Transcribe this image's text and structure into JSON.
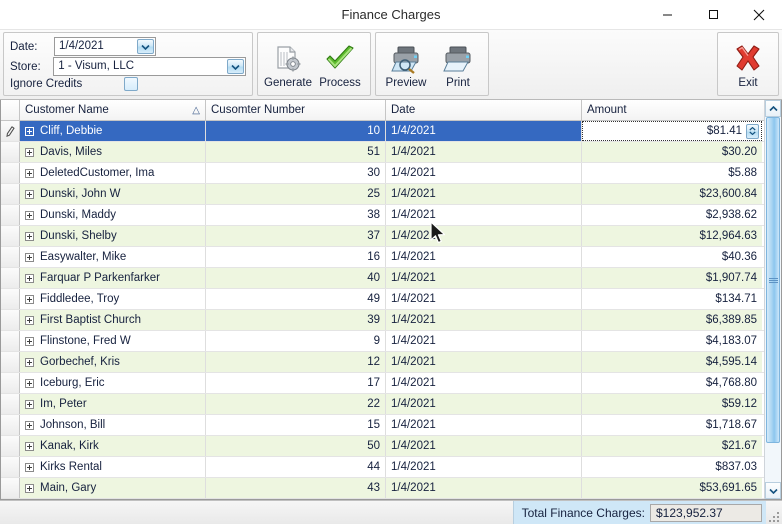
{
  "window": {
    "title": "Finance Charges",
    "minimize_label": "Minimize",
    "maximize_label": "Maximize",
    "close_label": "Close"
  },
  "toolbar": {
    "date_label": "Date:",
    "date_value": "1/4/2021",
    "store_label": "Store:",
    "store_value": "1 - Visum, LLC",
    "ignore_credits_label": "Ignore Credits",
    "ignore_credits_checked": false,
    "buttons": [
      {
        "label": "Generate",
        "icon": "document-gear-icon"
      },
      {
        "label": "Process",
        "icon": "green-check-icon"
      },
      {
        "label": "Preview",
        "icon": "printer-preview-icon"
      },
      {
        "label": "Print",
        "icon": "printer-icon"
      },
      {
        "label": "Exit",
        "icon": "red-x-icon"
      }
    ]
  },
  "grid": {
    "columns": [
      {
        "key": "name",
        "label": "Customer Name",
        "sort": "△"
      },
      {
        "key": "num",
        "label": "Cusomter Number",
        "sort": ""
      },
      {
        "key": "date",
        "label": "Date",
        "sort": ""
      },
      {
        "key": "amt",
        "label": "Amount",
        "sort": ""
      }
    ],
    "rows": [
      {
        "name": "Cliff, Debbie",
        "num": "10",
        "date": "1/4/2021",
        "amt": "$81.41",
        "selected": true,
        "editing": true
      },
      {
        "name": "Davis, Miles",
        "num": "51",
        "date": "1/4/2021",
        "amt": "$30.20",
        "selected": false,
        "editing": false
      },
      {
        "name": "DeletedCustomer, Ima",
        "num": "30",
        "date": "1/4/2021",
        "amt": "$5.88",
        "selected": false,
        "editing": false
      },
      {
        "name": "Dunski, John W",
        "num": "25",
        "date": "1/4/2021",
        "amt": "$23,600.84",
        "selected": false,
        "editing": false
      },
      {
        "name": "Dunski, Maddy",
        "num": "38",
        "date": "1/4/2021",
        "amt": "$2,938.62",
        "selected": false,
        "editing": false
      },
      {
        "name": "Dunski, Shelby",
        "num": "37",
        "date": "1/4/2021",
        "amt": "$12,964.63",
        "selected": false,
        "editing": false
      },
      {
        "name": "Easywalter, Mike",
        "num": "16",
        "date": "1/4/2021",
        "amt": "$40.36",
        "selected": false,
        "editing": false
      },
      {
        "name": "Farquar P Parkenfarker",
        "num": "40",
        "date": "1/4/2021",
        "amt": "$1,907.74",
        "selected": false,
        "editing": false
      },
      {
        "name": "Fiddledee, Troy",
        "num": "49",
        "date": "1/4/2021",
        "amt": "$134.71",
        "selected": false,
        "editing": false
      },
      {
        "name": "First Baptist Church",
        "num": "39",
        "date": "1/4/2021",
        "amt": "$6,389.85",
        "selected": false,
        "editing": false
      },
      {
        "name": "Flinstone, Fred W",
        "num": "9",
        "date": "1/4/2021",
        "amt": "$4,183.07",
        "selected": false,
        "editing": false
      },
      {
        "name": "Gorbechef, Kris",
        "num": "12",
        "date": "1/4/2021",
        "amt": "$4,595.14",
        "selected": false,
        "editing": false
      },
      {
        "name": "Iceburg, Eric",
        "num": "17",
        "date": "1/4/2021",
        "amt": "$4,768.80",
        "selected": false,
        "editing": false
      },
      {
        "name": "Im, Peter",
        "num": "22",
        "date": "1/4/2021",
        "amt": "$59.12",
        "selected": false,
        "editing": false
      },
      {
        "name": "Johnson, Bill",
        "num": "15",
        "date": "1/4/2021",
        "amt": "$1,718.67",
        "selected": false,
        "editing": false
      },
      {
        "name": "Kanak, Kirk",
        "num": "50",
        "date": "1/4/2021",
        "amt": "$21.67",
        "selected": false,
        "editing": false
      },
      {
        "name": "Kirks Rental",
        "num": "44",
        "date": "1/4/2021",
        "amt": "$837.03",
        "selected": false,
        "editing": false
      },
      {
        "name": "Main, Gary",
        "num": "43",
        "date": "1/4/2021",
        "amt": "$53,691.65",
        "selected": false,
        "editing": false
      }
    ]
  },
  "statusbar": {
    "total_label": "Total Finance Charges:",
    "total_value": "$123,952.37"
  },
  "colors": {
    "selection": "#3569c1",
    "row_alt": "#eef6e0",
    "status_panel": "#cfe7f7"
  }
}
